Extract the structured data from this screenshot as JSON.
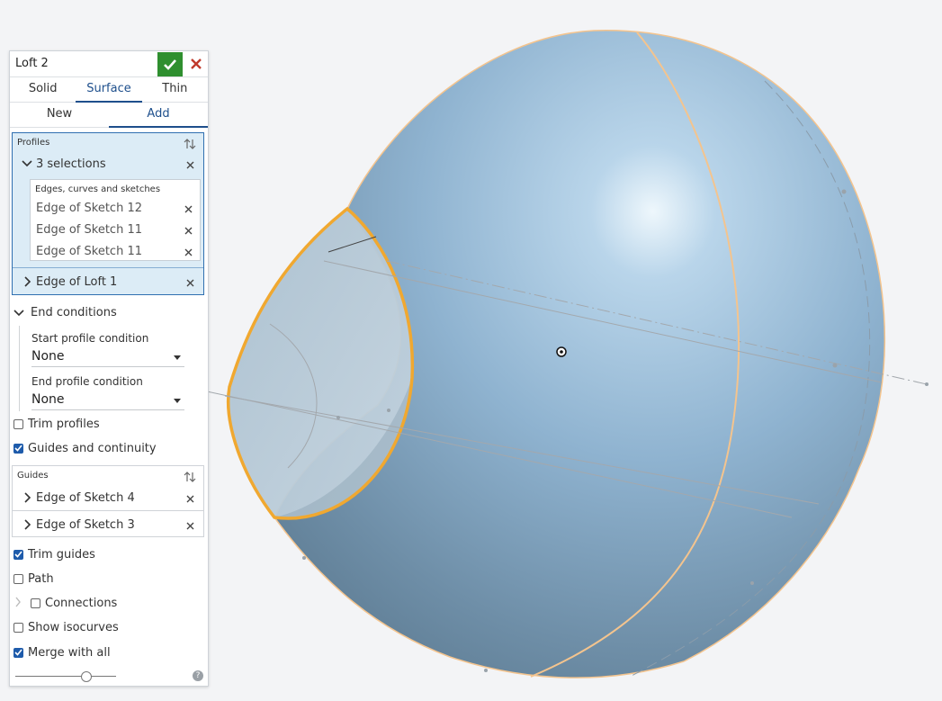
{
  "panel": {
    "title": "Loft 2",
    "body_tabs": [
      {
        "label": "Solid",
        "active": false
      },
      {
        "label": "Surface",
        "active": true
      },
      {
        "label": "Thin",
        "active": false
      }
    ],
    "op_tabs": [
      {
        "label": "New",
        "active": false
      },
      {
        "label": "Add",
        "active": true
      }
    ],
    "profiles": {
      "header": "Profiles",
      "group_label": "3 selections",
      "list_header": "Edges, curves and sketches",
      "items": [
        "Edge of Sketch 12",
        "Edge of Sketch 11",
        "Edge of Sketch 11"
      ],
      "extra_item": "Edge of Loft 1"
    },
    "end_conditions": {
      "header": "End conditions",
      "start_label": "Start profile condition",
      "start_value": "None",
      "end_label": "End profile condition",
      "end_value": "None"
    },
    "checkboxes": {
      "trim_profiles": {
        "label": "Trim profiles",
        "checked": false
      },
      "guides_continuity": {
        "label": "Guides and continuity",
        "checked": true
      },
      "trim_guides": {
        "label": "Trim guides",
        "checked": true
      },
      "path": {
        "label": "Path",
        "checked": false
      },
      "connections": {
        "label": "Connections",
        "checked": false
      },
      "show_isocurves": {
        "label": "Show isocurves",
        "checked": false
      },
      "merge_with_all": {
        "label": "Merge with all",
        "checked": true
      }
    },
    "guides": {
      "header": "Guides",
      "items": [
        "Edge of Sketch 4",
        "Edge of Sketch 3"
      ]
    },
    "slider": {
      "value": 0.7
    },
    "help_glyph": "?"
  },
  "colors": {
    "accent": "#1e4f8c",
    "ok_green": "#2f8f2f",
    "cancel_red": "#c0392b",
    "surface": "#8fb5d3",
    "edge_highlight": "#f0a830",
    "edge_light": "#f4c48e"
  }
}
